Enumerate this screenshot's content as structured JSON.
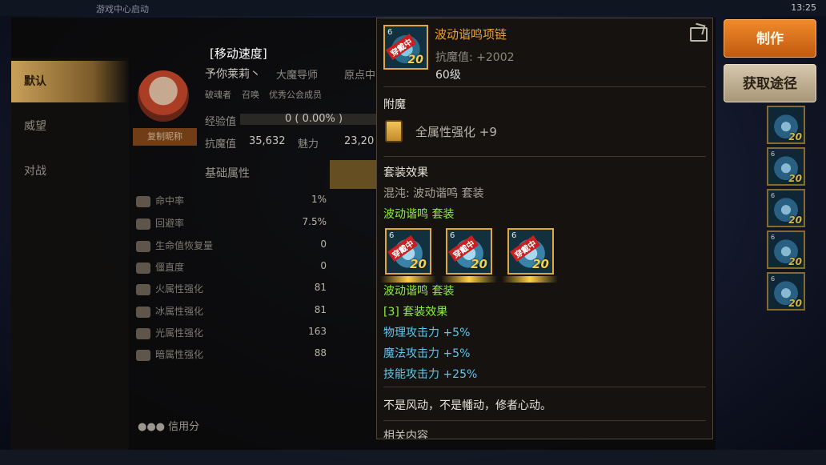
{
  "status_bar": {
    "center_text": "游戏中心启动",
    "time": "13:25"
  },
  "left_nav": {
    "items": [
      {
        "label": "默认"
      },
      {
        "label": "威望"
      },
      {
        "label": "对战"
      }
    ]
  },
  "profile": {
    "move_speed_label": "[移动速度]",
    "name": "予你莱莉丶",
    "guild_role": "大魔导师",
    "guild_name": "原点中",
    "tag_label": "破魂者",
    "tag_value": "召唤",
    "tag_member": "优秀公会成员",
    "exp_label": "经验值",
    "exp_value": "0 ( 0.00% )",
    "kangmo_label": "抗魔值",
    "kangmo_value": "35,632",
    "charm_label": "魅力",
    "charm_value": "23,20",
    "copy_btn": "复制昵称",
    "basic_tab": "基础属性",
    "credit_label": "信用分"
  },
  "stats": [
    {
      "label": "命中率",
      "value": "1%"
    },
    {
      "label": "回避率",
      "value": "7.5%"
    },
    {
      "label": "生命值恢复量",
      "value": "0"
    },
    {
      "label": "僵直度",
      "value": "0"
    },
    {
      "label": "火属性强化",
      "value": "81"
    },
    {
      "label": "冰属性强化",
      "value": "81"
    },
    {
      "label": "光属性强化",
      "value": "163"
    },
    {
      "label": "暗属性强化",
      "value": "88"
    }
  ],
  "tooltip": {
    "item_name": "波动谐鸣项链",
    "kangmo": "抗魔值: +2002",
    "level": "60级",
    "icon_badge": "穿戴中",
    "icon_level": "20",
    "icon_corner": "6",
    "enchant_title": "附魔",
    "enchant_text": "全属性强化 +9",
    "set_title": "套装效果",
    "set_chaos": "混沌: 波动谐鸣 套装",
    "set_name_1": "波动谐鸣  套装",
    "set_name_2": "波动谐鸣  套装",
    "set_bonus_title": "[3] 套装效果",
    "bonus_1": "物理攻击力 +5%",
    "bonus_2": "魔法攻击力 +5%",
    "bonus_3": "技能攻击力 +25%",
    "flavor": "不是风动，不是幡动，修者心动。",
    "related": "相关内容"
  },
  "buttons": {
    "make": "制作",
    "get_path": "获取途径"
  },
  "colors": {
    "item_name": "#f0a030",
    "set_green": "#8ef03a",
    "bonus_blue": "#5cc8f0",
    "make_button": "#e07420"
  }
}
